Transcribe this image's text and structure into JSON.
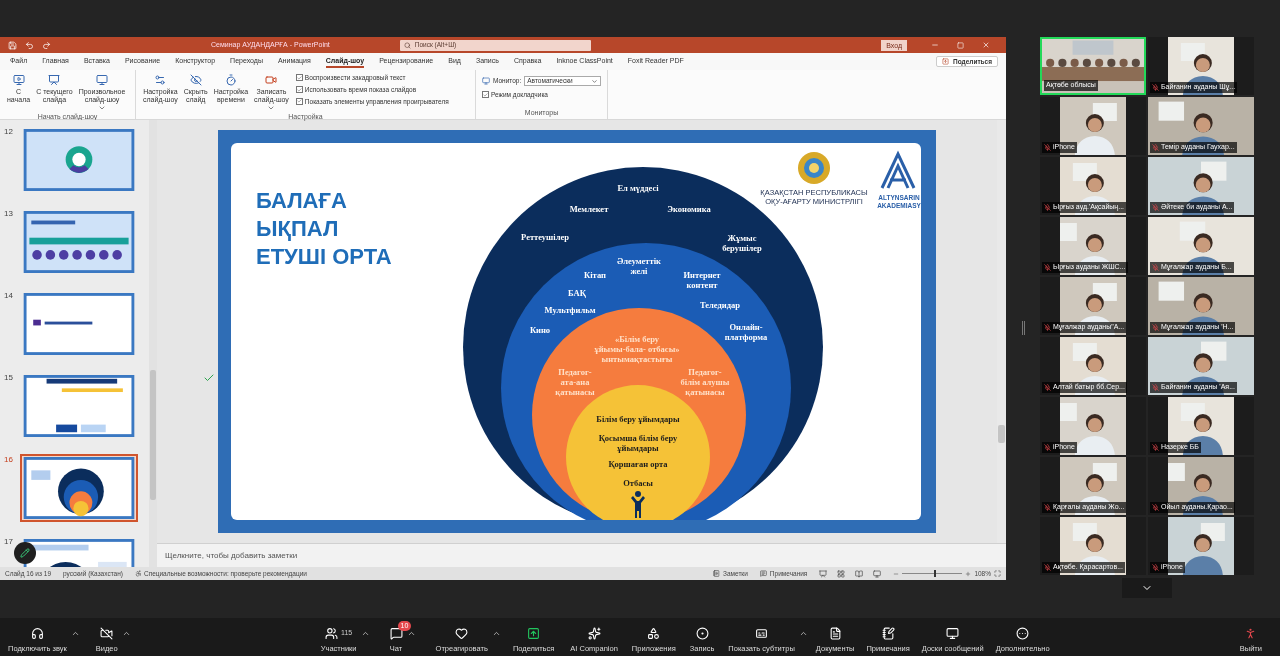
{
  "window": {
    "title": "Семинар АУДАНДАРҒА - PowerPoint",
    "search": {
      "placeholder": "Поиск (Alt+Ш)"
    },
    "sign_in": "Вход"
  },
  "ribbon_tabs": [
    {
      "label": "Файл",
      "selected": false
    },
    {
      "label": "Главная",
      "selected": false
    },
    {
      "label": "Вставка",
      "selected": false
    },
    {
      "label": "Рисование",
      "selected": false
    },
    {
      "label": "Конструктор",
      "selected": false
    },
    {
      "label": "Переходы",
      "selected": false
    },
    {
      "label": "Анимация",
      "selected": false
    },
    {
      "label": "Слайд-шоу",
      "selected": true
    },
    {
      "label": "Рецензирование",
      "selected": false
    },
    {
      "label": "Вид",
      "selected": false
    },
    {
      "label": "Запись",
      "selected": false
    },
    {
      "label": "Справка",
      "selected": false
    },
    {
      "label": "Inknoe ClassPoint",
      "selected": false
    },
    {
      "label": "Foxit Reader PDF",
      "selected": false
    }
  ],
  "share_button": "Поделиться",
  "ribbon": {
    "start_group": {
      "label": "Начать слайд-шоу",
      "buttons": [
        {
          "label": "С\nначала",
          "dropdown": false
        },
        {
          "label": "С текущего\nслайда",
          "dropdown": false
        },
        {
          "label": "Произвольное\nслайд-шоу",
          "dropdown": true
        }
      ]
    },
    "setup_group": {
      "label": "Настройка",
      "buttons": [
        {
          "label": "Настройка\nслайд-шоу",
          "dropdown": false
        },
        {
          "label": "Скрыть\nслайд",
          "dropdown": false
        },
        {
          "label": "Настройка\nвремени",
          "dropdown": false
        },
        {
          "label": "Записать\nслайд-шоу",
          "dropdown": true
        }
      ],
      "checkboxes": [
        {
          "label": "Воспроизвести закадровый текст",
          "checked": true
        },
        {
          "label": "Использовать время показа слайдов",
          "checked": true
        },
        {
          "label": "Показать элементы управления проигрывателя",
          "checked": true
        }
      ]
    },
    "monitors_group": {
      "label": "Мониторы",
      "monitor_label": "Монитор:",
      "monitor_value": "Автоматически",
      "presenter": {
        "label": "Режим докладчика",
        "checked": true
      }
    }
  },
  "slides": [
    {
      "number": "12",
      "kind": "cycle",
      "selected": false
    },
    {
      "number": "13",
      "kind": "process",
      "selected": false
    },
    {
      "number": "14",
      "kind": "question",
      "selected": false
    },
    {
      "number": "15",
      "kind": "table",
      "selected": false
    },
    {
      "number": "16",
      "kind": "rings",
      "selected": true
    },
    {
      "number": "17",
      "kind": "rings-list",
      "selected": false
    }
  ],
  "slide": {
    "title": "БАЛАҒА\nЫҚПАЛ\nЕТУШІ ОРТА",
    "emblem_caption": "ҚАЗАҚСТАН РЕСПУБЛИКАСЫ\nОҚУ-АҒАРТУ МИНИСТРЛІГІ",
    "logo_text": "ALTYNSARIN\nAKADEMIASY",
    "rings": [
      {
        "color": "#0b2d5c",
        "labels": [
          "Ел мүддесі",
          "Мемлекет",
          "Экономика",
          "Реттеушілер",
          "Жұмыс\nберушілер"
        ]
      },
      {
        "color": "#1b5cb5",
        "labels": [
          "Әлеуметтік\nжелі",
          "Кітап",
          "Интернет\nконтент",
          "БАҚ",
          "Теледидар",
          "Мультфильм",
          "Кино",
          "Онлайн-\nплатформа"
        ]
      },
      {
        "color": "#f57c3e",
        "labels": [
          "«Білім беру\nұйымы-бала- отбасы»\nынтымақтастығы",
          "Педагог-\nата-ана\nқатынасы",
          "Педагог-\nбілім алушы\nқатынасы"
        ]
      },
      {
        "color": "#f5c237",
        "labels": [
          "Білім беру ұйымдары",
          "Қосымша білім беру\nұйымдары",
          "Қоршаған орта",
          "Отбасы"
        ]
      }
    ]
  },
  "notes_placeholder": "Щелкните, чтобы добавить заметки",
  "status_bar": {
    "slide": "Слайд 16 из 19",
    "language": "русский (Казахстан)",
    "accessibility": "Специальные возможности: проверьте рекомендации",
    "notes": "Заметки",
    "comments": "Примечания",
    "zoom_slider": {
      "level": 0.52
    },
    "zoom": "108%"
  },
  "participants": [
    {
      "name": "Ақтөбе облысы",
      "muted": false,
      "active": true,
      "portrait": false
    },
    {
      "name": "Байғанин ауданы Шұ...",
      "muted": true,
      "active": false,
      "portrait": true
    },
    {
      "name": "iPhone",
      "muted": true,
      "active": false,
      "portrait": true
    },
    {
      "name": "Темір ауданы Гаухар...",
      "muted": true,
      "active": false,
      "portrait": false
    },
    {
      "name": "Ырғыз ауд.'Ақсайың...",
      "muted": true,
      "active": false,
      "portrait": true
    },
    {
      "name": "Әйтеке би ауданы  А...",
      "muted": true,
      "active": false,
      "portrait": false
    },
    {
      "name": "Ырғыз ауданы  ЖШС...",
      "muted": true,
      "active": false,
      "portrait": true
    },
    {
      "name": "Мұғалжар ауданы Б...",
      "muted": true,
      "active": false,
      "portrait": false
    },
    {
      "name": "Мұғалжар ауданы\"А...",
      "muted": true,
      "active": false,
      "portrait": true
    },
    {
      "name": "Мұғалжар ауданы 'Н...",
      "muted": true,
      "active": false,
      "portrait": false
    },
    {
      "name": "Алтай батыр бб.Сер...",
      "muted": true,
      "active": false,
      "portrait": true
    },
    {
      "name": "Байғанин ауданы  'Ая...",
      "muted": true,
      "active": false,
      "portrait": false
    },
    {
      "name": "iPhone",
      "muted": true,
      "active": false,
      "portrait": true
    },
    {
      "name": "Назерке ББ",
      "muted": true,
      "active": false,
      "portrait": true
    },
    {
      "name": "Қарғалы ауданы Жо...",
      "muted": true,
      "active": false,
      "portrait": true
    },
    {
      "name": "Ойыл ауданы.Қарао...",
      "muted": true,
      "active": false,
      "portrait": true
    },
    {
      "name": "Ақтөбе. Қарасартов...",
      "muted": true,
      "active": false,
      "portrait": true
    },
    {
      "name": "iPhone",
      "muted": true,
      "active": false,
      "portrait": true
    }
  ],
  "toolbar": [
    {
      "label": "Подключить звук",
      "caret": true
    },
    {
      "label": "Видео",
      "caret": true
    },
    {
      "label": "Участники",
      "count": "115",
      "caret": true
    },
    {
      "label": "Чат",
      "badge": "10",
      "caret": true
    },
    {
      "label": "Отреагировать",
      "caret": true
    },
    {
      "label": "Поделиться",
      "caret": false
    },
    {
      "label": "AI Companion",
      "caret": false
    },
    {
      "label": "Приложения",
      "caret": false
    },
    {
      "label": "Запись",
      "caret": false
    },
    {
      "label": "Показать субтитры",
      "caret": true
    },
    {
      "label": "Документы",
      "caret": false
    },
    {
      "label": "Примечания",
      "caret": false
    },
    {
      "label": "Доски сообщений",
      "caret": false
    },
    {
      "label": "Дополнительно",
      "caret": false
    },
    {
      "label": "Выйти",
      "caret": false
    }
  ]
}
